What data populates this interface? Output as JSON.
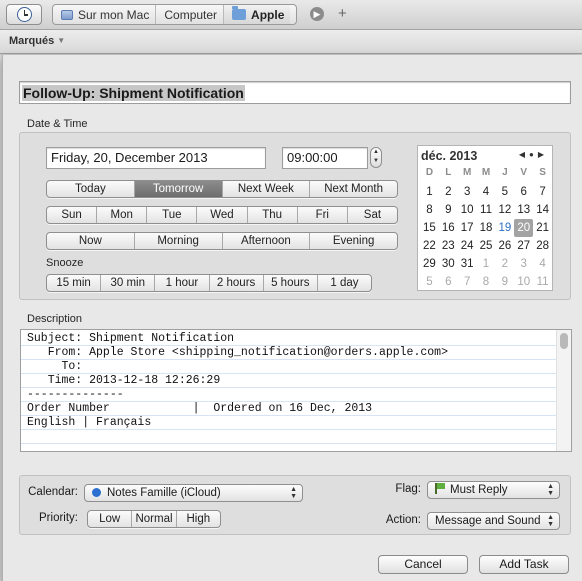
{
  "finder": {
    "path": [
      "Sur mon Mac",
      "Computer",
      "Apple"
    ],
    "tags_label": "Marqués"
  },
  "title": "Follow-Up: Shipment Notification",
  "datetime": {
    "section_label": "Date & Time",
    "date_value": "Friday, 20, December 2013",
    "time_value": "09:00:00",
    "quick": [
      "Today",
      "Tomorrow",
      "Next Week",
      "Next Month"
    ],
    "quick_selected": 1,
    "weekdays": [
      "Sun",
      "Mon",
      "Tue",
      "Wed",
      "Thu",
      "Fri",
      "Sat"
    ],
    "times_of_day": [
      "Now",
      "Morning",
      "Afternoon",
      "Evening"
    ],
    "snooze_label": "Snooze",
    "snooze": [
      "15 min",
      "30 min",
      "1 hour",
      "2 hours",
      "5 hours",
      "1 day"
    ]
  },
  "calendar": {
    "month_label": "déc. 2013",
    "day_headers": [
      "D",
      "L",
      "M",
      "M",
      "J",
      "V",
      "S"
    ],
    "weeks": [
      [
        "1",
        "2",
        "3",
        "4",
        "5",
        "6",
        "7"
      ],
      [
        "8",
        "9",
        "10",
        "11",
        "12",
        "13",
        "14"
      ],
      [
        "15",
        "16",
        "17",
        "18",
        "19",
        "20",
        "21"
      ],
      [
        "22",
        "23",
        "24",
        "25",
        "26",
        "27",
        "28"
      ],
      [
        "29",
        "30",
        "31",
        "1",
        "2",
        "3",
        "4"
      ],
      [
        "5",
        "6",
        "7",
        "8",
        "9",
        "10",
        "11"
      ]
    ],
    "today": "19",
    "selected": "20"
  },
  "description": {
    "label": "Description",
    "lines": [
      "Subject: Shipment Notification",
      "   From: Apple Store <shipping_notification@orders.apple.com>",
      "     To:",
      "   Time: 2013-12-18 12:26:29",
      "--------------",
      "",
      "Order Number            |  Ordered on 16 Dec, 2013",
      "",
      "English | Français"
    ]
  },
  "options": {
    "calendar_label": "Calendar:",
    "calendar_value": "Notes Famille (iCloud)",
    "calendar_color": "#2b6fd0",
    "priority_label": "Priority:",
    "priorities": [
      "Low",
      "Normal",
      "High"
    ],
    "flag_label": "Flag:",
    "flag_value": "Must Reply",
    "action_label": "Action:",
    "action_value": "Message and Sound"
  },
  "buttons": {
    "cancel": "Cancel",
    "add_task": "Add Task"
  }
}
